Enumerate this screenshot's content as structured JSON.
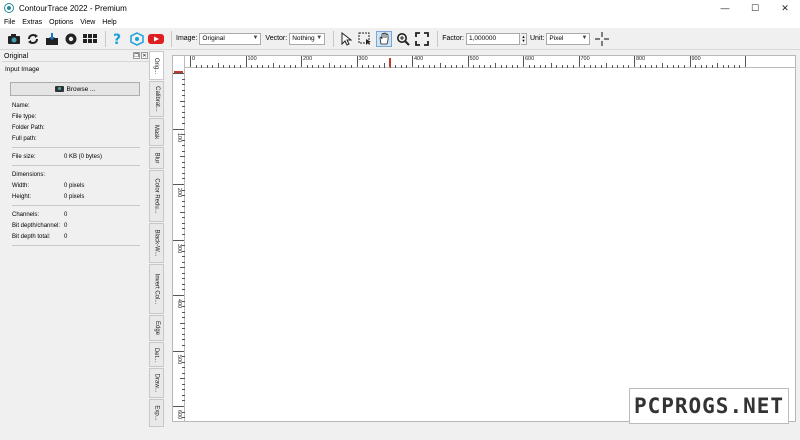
{
  "window": {
    "title": "ContourTrace 2022 - Premium",
    "controls": [
      "—",
      "☐",
      "✕"
    ]
  },
  "menu": [
    {
      "label": "File",
      "underline": "F"
    },
    {
      "label": "Extras",
      "underline": "x"
    },
    {
      "label": "Options",
      "underline": "O"
    },
    {
      "label": "View",
      "underline": "V"
    },
    {
      "label": "Help",
      "underline": "H"
    }
  ],
  "toolbar": {
    "image_label": "Image:",
    "image_value": "Original",
    "vector_label": "Vector:",
    "vector_value": "Nothing",
    "factor_label": "Factor:",
    "factor_value": "1,000000",
    "unit_label": "Unit:",
    "unit_value": "Pixel",
    "colors": {
      "accent": "#1a73c4",
      "youtube": "#e02020",
      "help": "#1aa0d8"
    }
  },
  "panel": {
    "title": "Original",
    "section": "Input Image",
    "browse_label": "Browse ...",
    "rows": [
      {
        "k": "Name:",
        "v": ""
      },
      {
        "k": "File type:",
        "v": ""
      },
      {
        "k": "Folder Path:",
        "v": ""
      },
      {
        "k": "Full path:",
        "v": ""
      }
    ],
    "filesize": {
      "k": "File size:",
      "v": "0 KB (0 bytes)"
    },
    "dims_title": "Dimensions:",
    "dims": [
      {
        "k": "Width:",
        "v": "0 pixels"
      },
      {
        "k": "Height:",
        "v": "0 pixels"
      }
    ],
    "channels": [
      {
        "k": "Channels:",
        "v": "0"
      },
      {
        "k": "Bit depth/channel:",
        "v": "0"
      },
      {
        "k": "Bit depth total:",
        "v": "0"
      }
    ]
  },
  "tabs": [
    "Orig...",
    "Calibrat...",
    "Mask",
    "Blur",
    "Color Redu...",
    "Black-W...",
    "Invert Col...",
    "Edge",
    "Det...",
    "Draw...",
    "Exp..."
  ],
  "rulers": {
    "top": [
      "0",
      "100",
      "200",
      "300",
      "400",
      "500",
      "600",
      "700",
      "800",
      "900"
    ],
    "left": [
      "100",
      "200",
      "300",
      "400",
      "500",
      "600"
    ]
  },
  "watermark": "PCPROGS.NET"
}
